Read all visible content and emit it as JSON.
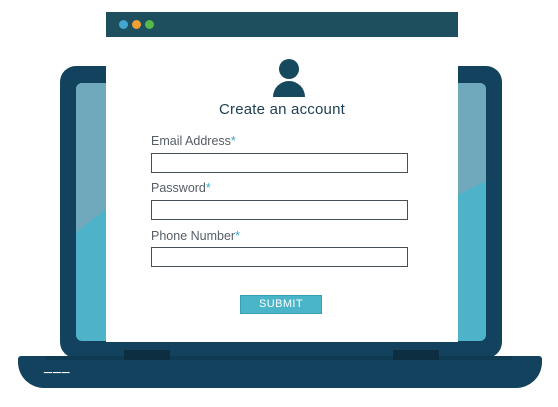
{
  "form": {
    "title": "Create an account",
    "required_marker": "*",
    "fields": [
      {
        "label": "Email Address",
        "value": ""
      },
      {
        "label": "Password",
        "value": ""
      },
      {
        "label": "Phone Number",
        "value": ""
      }
    ],
    "submit_label": "SUBMIT"
  },
  "laptop": {
    "base_indicator": "───"
  },
  "colors": {
    "laptop_frame": "#12425e",
    "screen_accent": "#4eb3c9",
    "titlebar": "#1d4f5f",
    "required_star": "#3aa5c7",
    "submit_button": "#4ab5c9",
    "window_dots": [
      "#42a6cf",
      "#f2a033",
      "#55b848"
    ]
  }
}
